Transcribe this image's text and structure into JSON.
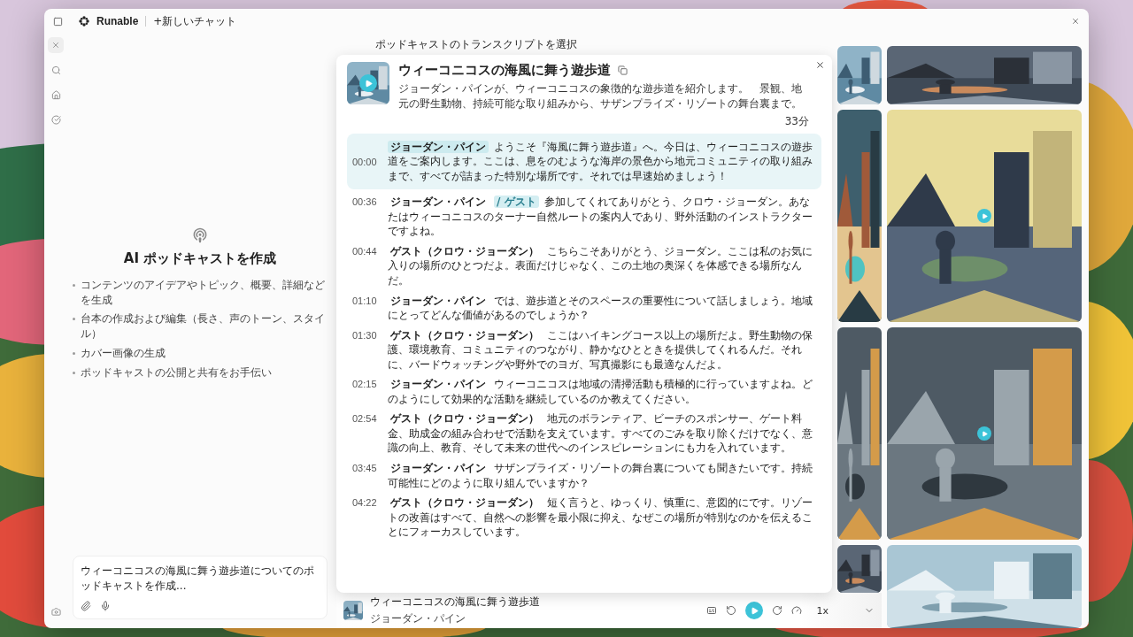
{
  "app": {
    "logo_text": "Runable",
    "new_chat": "+新しいチャット"
  },
  "empty_state": {
    "title": "AI ポッドキャストを作成",
    "bullets": [
      "コンテンツのアイデアやトピック、概要、詳細などを生成",
      "台本の作成および編集（長さ、声のトーン、スタイル）",
      "カバー画像の生成",
      "ポッドキャストの公開と共有をお手伝い"
    ]
  },
  "composer": {
    "value": "ウィーコニコスの海風に舞う遊歩道についてのポッドキャストを作成..."
  },
  "transcript_picker": {
    "label": "ポッドキャストのトランスクリプトを選択"
  },
  "episode": {
    "title": "ウィーコニコスの海風に舞う遊歩道",
    "description": "ジョーダン・パインが、ウィーコニコスの象徴的な遊歩道を紹介します。　景観、地元の野生動物、持続可能な取り組みから、サザンプライズ・リゾートの舞台裏まで。",
    "duration": "33分"
  },
  "transcript": [
    {
      "time": "00:00",
      "speaker": "ジョーダン・パイン",
      "text": "ようこそ『海風に舞う遊歩道』へ。今日は、ウィーコニコスの遊歩道をご案内します。ここは、息をのむような海岸の景色から地元コミュニティの取り組みまで、すべてが詰まった特別な場所です。それでは早速始めましょう！",
      "selected": true
    },
    {
      "time": "00:36",
      "speaker": "ジョーダン・パイン",
      "tag": "/ ゲスト",
      "text": "参加してくれてありがとう、クロウ・ジョーダン。あなたはウィーコニコスのターナー自然ルートの案内人であり、野外活動のインストラクターですよね。",
      "selected": false
    },
    {
      "time": "00:44",
      "speaker": "ゲスト（クロウ・ジョーダン）",
      "text": "こちらこそありがとう、ジョーダン。ここは私のお気に入りの場所のひとつだよ。表面だけじゃなく、この土地の奥深くを体感できる場所なんだ。",
      "selected": false
    },
    {
      "time": "01:10",
      "speaker": "ジョーダン・パイン",
      "text": "では、遊歩道とそのスペースの重要性について話しましょう。地域にとってどんな価値があるのでしょうか？",
      "selected": false
    },
    {
      "time": "01:30",
      "speaker": "ゲスト（クロウ・ジョーダン）",
      "text": "ここはハイキングコース以上の場所だよ。野生動物の保護、環境教育、コミュニティのつながり、静かなひとときを提供してくれるんだ。それに、バードウォッチングや野外でのヨガ、写真撮影にも最適なんだよ。",
      "selected": false
    },
    {
      "time": "02:15",
      "speaker": "ジョーダン・パイン",
      "text": "ウィーコニコスは地域の清掃活動も積極的に行っていますよね。どのようにして効果的な活動を継続しているのか教えてください。",
      "selected": false
    },
    {
      "time": "02:54",
      "speaker": "ゲスト（クロウ・ジョーダン）",
      "text": "地元のボランティア、ビーチのスポンサー、ゲート料金、助成金の組み合わせで活動を支えています。すべてのごみを取り除くだけでなく、意識の向上、教育、そして未来の世代へのインスピレーションにも力を入れています。",
      "selected": false
    },
    {
      "time": "03:45",
      "speaker": "ジョーダン・パイン",
      "text": "サザンプライズ・リゾートの舞台裏についても聞きたいです。持続可能性にどのように取り組んでいますか？",
      "selected": false
    },
    {
      "time": "04:22",
      "speaker": "ゲスト（クロウ・ジョーダン）",
      "text": "短く言うと、ゆっくり、慎重に、意図的にです。リゾートの改善はすべて、自然への影響を最小限に抑え、なぜこの場所が特別なのかを伝えることにフォーカスしています。",
      "selected": false
    }
  ],
  "player": {
    "title": "ウィーコニコスの海風に舞う遊歩道",
    "artist": "ジョーダン・パイン",
    "speed": "1x"
  }
}
